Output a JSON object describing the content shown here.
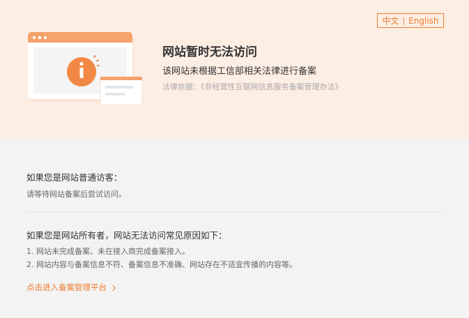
{
  "lang": {
    "zh": "中文",
    "sep": "|",
    "en": "English"
  },
  "banner": {
    "title": "网站暂时无法访问",
    "subtitle": "该网站未根据工信部相关法律进行备案",
    "law": "法律依据：《非经营性互联网信息服务备案管理办法》"
  },
  "visitor": {
    "heading": "如果您是网站普通访客：",
    "text": "请等待网站备案后尝试访问。"
  },
  "owner": {
    "heading": "如果您是网站所有者，网站无法访问常见原因如下：",
    "reasons": [
      "1. 网站未完成备案、未在接入商完成备案接入。",
      "2. 网站内容与备案信息不符、备案信息不准确、网站存在不适宜传播的内容等。"
    ]
  },
  "link": {
    "label": "点击进入备案管理平台"
  },
  "colors": {
    "accent": "#ef7d32",
    "banner_bg": "#fdeee4",
    "page_bg": "#f3f3f3"
  },
  "icons": [
    "browser-window-icon",
    "info-icon",
    "chevron-right-icon"
  ]
}
